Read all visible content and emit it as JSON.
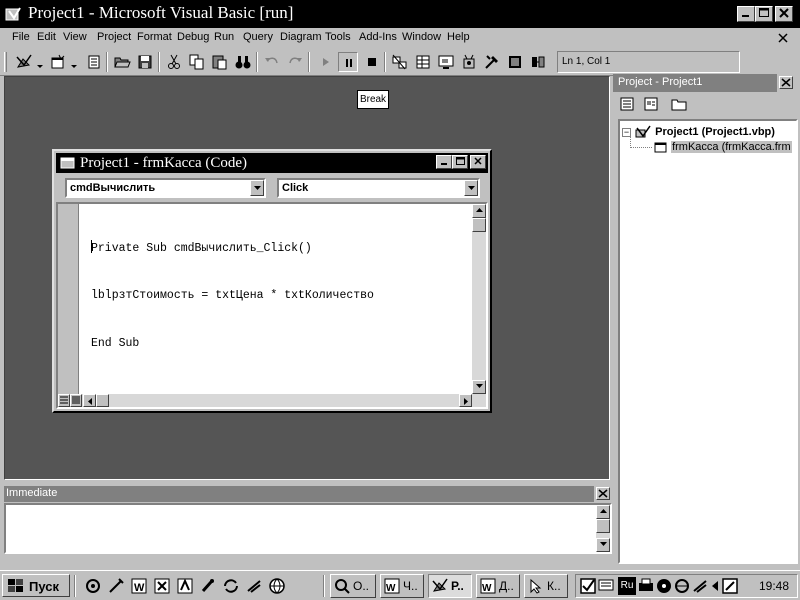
{
  "window": {
    "title": "Project1 - Microsoft Visual Basic [run]"
  },
  "menu": {
    "items": [
      {
        "label": "File"
      },
      {
        "label": "Edit"
      },
      {
        "label": "View"
      },
      {
        "label": "Project"
      },
      {
        "label": "Format"
      },
      {
        "label": "Debug"
      },
      {
        "label": "Run"
      },
      {
        "label": "Query"
      },
      {
        "label": "Diagram"
      },
      {
        "label": "Tools"
      },
      {
        "label": "Add-Ins"
      },
      {
        "label": "Window"
      },
      {
        "label": "Help"
      }
    ]
  },
  "toolbar": {
    "position": "Ln 1, Col 1",
    "tooltip": "Break"
  },
  "code_window": {
    "title": "Project1 - frmKacca (Code)",
    "object_combo": "cmdВычислить",
    "procedure_combo": "Click",
    "lines": [
      "Private Sub cmdВычислить_Click()",
      "lblрзтСтоимость = txtЦена * txtКоличество",
      "End Sub"
    ]
  },
  "project_explorer": {
    "title": "Project - Project1",
    "root": "Project1 (Project1.vbp)",
    "child": "frmKacca (frmKacca.frm"
  },
  "immediate": {
    "title": "Immediate"
  },
  "taskbar": {
    "start_label": "Пуск",
    "tasks": [
      {
        "label": "О.."
      },
      {
        "label": "Ч.."
      },
      {
        "label": "Р.."
      },
      {
        "label": "Д.."
      },
      {
        "label": "К.."
      }
    ],
    "lang": "Ru",
    "clock": "19:48"
  }
}
